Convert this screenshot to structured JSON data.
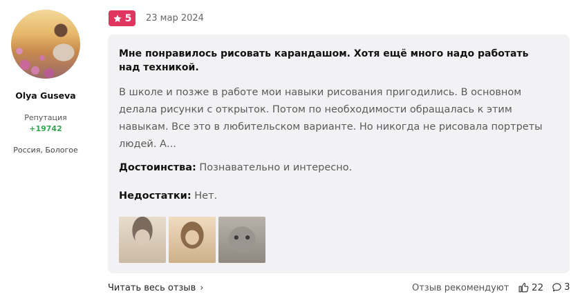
{
  "author": {
    "name": "Olya Guseva",
    "reputation_label": "Репутация",
    "reputation_value": "+19742",
    "location": "Россия, Бологое"
  },
  "review": {
    "rating": "5",
    "date": "23 мар 2024",
    "title": "Мне понравилось рисовать карандашом. Хотя ещё много надо работать над техникой.",
    "body": "В школе и позже в работе мои навыки рисования пригодились. В основном делала рисунки с открыток. Потом по необходимости обращалась к этим навыкам. Все это в любительском варианте. Но никогда не рисовала портреты людей. А...",
    "pros_label": "Достоинства:",
    "pros_text": "Познавательно и интересно.",
    "cons_label": "Недостатки:",
    "cons_text": "Нет.",
    "photo_count": 3
  },
  "footer": {
    "read_more": "Читать весь отзыв",
    "recommend_label": "Отзыв рекомендуют",
    "likes": "22",
    "comments": "3"
  },
  "colors": {
    "rating_badge": "#e0355e",
    "reputation": "#2fa84f",
    "card_bg": "#f2f2f4"
  },
  "icons": [
    "star-icon",
    "chevron-right-icon",
    "thumbs-up-icon",
    "comment-icon"
  ]
}
